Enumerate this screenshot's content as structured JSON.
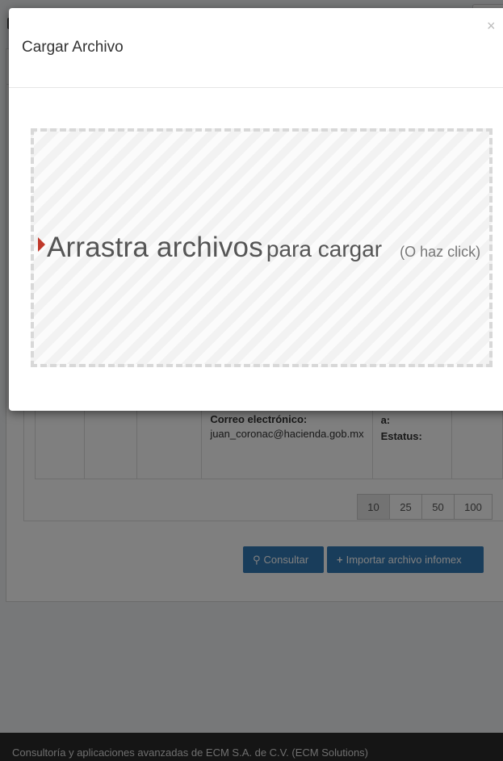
{
  "page": {
    "table": {
      "contact_label": "Correo electrónico:",
      "contact_value": "juan_coronac@hacienda.gob.mx",
      "delivery_label": "a:",
      "status_label": "Estatus:"
    },
    "pagination": [
      "10",
      "25",
      "50",
      "100"
    ],
    "pagination_active": "10",
    "buttons": {
      "consult": "Consultar",
      "import": "Importar archivo infomex"
    },
    "footer": "Consultoría y aplicaciones avanzadas de ECM S.A. de C.V. (ECM Solutions)"
  },
  "modal": {
    "title": "Cargar Archivo",
    "close": "×",
    "dropzone": {
      "main": "Arrastra archivos",
      "secondary": "para cargar",
      "hint": "(O haz click)"
    }
  },
  "icons": {
    "consult": "search-icon",
    "import": "plus-icon",
    "dropzone": "caret-right-icon"
  },
  "colors": {
    "primary": "#337ab7",
    "caret": "#c0392b",
    "footer_bg": "#2a2a2a"
  }
}
